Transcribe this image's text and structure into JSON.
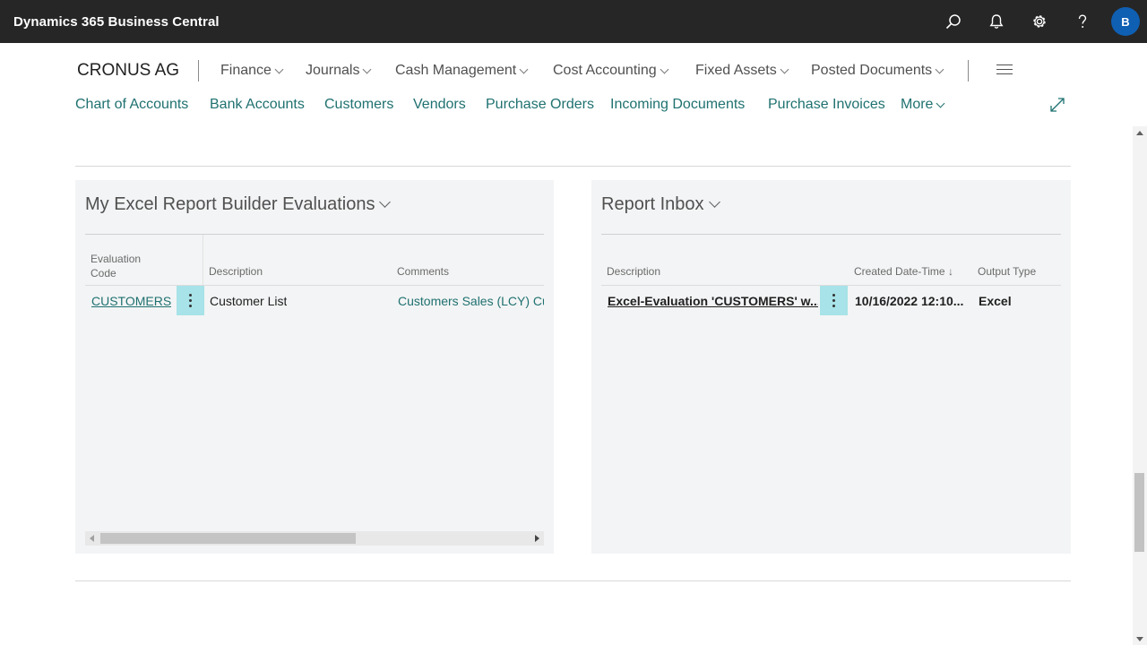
{
  "app": {
    "title": "Dynamics 365 Business Central",
    "avatar_initial": "B"
  },
  "appbar_icons": [
    "search-icon",
    "bell-icon",
    "gear-icon",
    "help-icon"
  ],
  "company": "CRONUS AG",
  "menus": [
    {
      "label": "Finance"
    },
    {
      "label": "Journals"
    },
    {
      "label": "Cash Management"
    },
    {
      "label": "Cost Accounting"
    },
    {
      "label": "Fixed Assets"
    },
    {
      "label": "Posted Documents"
    }
  ],
  "links": [
    {
      "label": "Chart of Accounts"
    },
    {
      "label": "Bank Accounts"
    },
    {
      "label": "Customers"
    },
    {
      "label": "Vendors"
    },
    {
      "label": "Purchase Orders"
    },
    {
      "label": "Incoming Documents"
    },
    {
      "label": "Purchase Invoices"
    },
    {
      "label": "More"
    }
  ],
  "evaluations": {
    "title": "My Excel Report Builder Evaluations",
    "columns": {
      "code_line1": "Evaluation",
      "code_line2": "Code",
      "description": "Description",
      "comments": "Comments"
    },
    "rows": [
      {
        "code": "CUSTOMERS",
        "description": "Customer List",
        "comments": "Customers Sales (LCY) Curr"
      }
    ]
  },
  "inbox": {
    "title": "Report Inbox",
    "columns": {
      "description": "Description",
      "created": "Created Date-Time",
      "created_sort": "↓",
      "output": "Output Type"
    },
    "rows": [
      {
        "description": "Excel-Evaluation 'CUSTOMERS' w...",
        "created": "10/16/2022 12:10...",
        "output": "Excel"
      }
    ]
  },
  "colors": {
    "appbar": "#262626",
    "link": "#1f7170",
    "avatar": "#0f5fb3",
    "row_action": "#a7e3e8"
  }
}
